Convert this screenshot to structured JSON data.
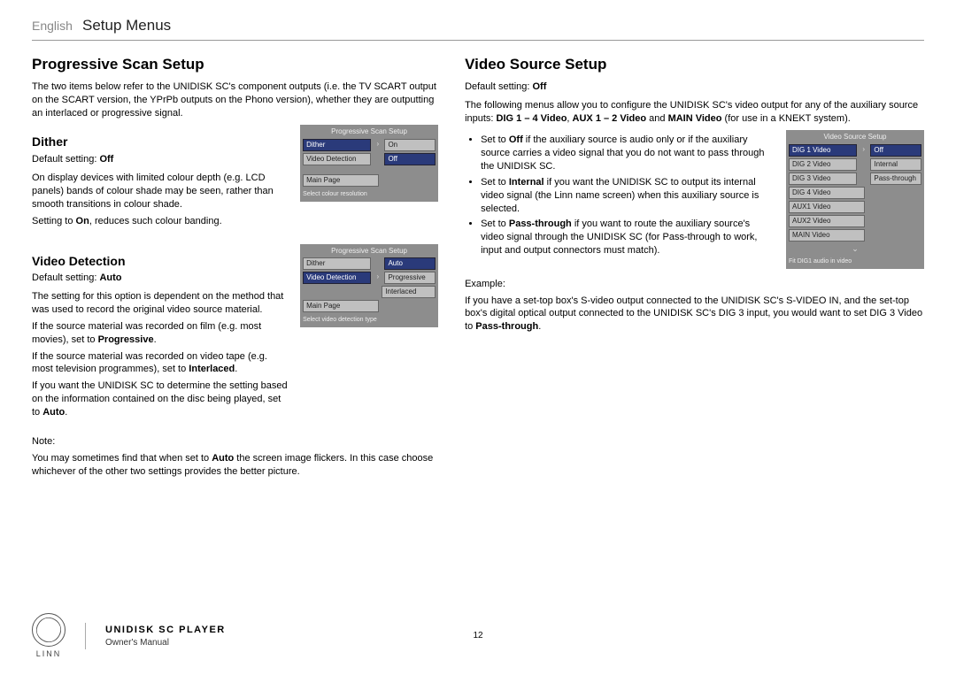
{
  "header": {
    "language": "English",
    "title": "Setup Menus"
  },
  "left": {
    "h2": "Progressive Scan Setup",
    "intro": "The two items below refer to the UNIDISK SC's component outputs (i.e. the TV SCART output on the SCART version, the YPrPb outputs on the Phono version), whether they are outputting an interlaced or progressive signal.",
    "dither": {
      "h3": "Dither",
      "default_label": "Default setting: ",
      "default_value": "Off",
      "p1": "On display devices with limited colour depth (e.g. LCD panels) bands of colour shade may be seen, rather than smooth transitions in colour shade.",
      "p2_a": "Setting to ",
      "p2_b": "On",
      "p2_c": ", reduces such colour banding.",
      "shot": {
        "title": "Progressive Scan Setup",
        "rows": [
          {
            "left": "Dither",
            "sel": true,
            "right": "On",
            "rightSel": false
          },
          {
            "left": "Video Detection",
            "sel": false,
            "right": "Off",
            "rightSel": true
          },
          {
            "left_spacer": true
          },
          {
            "left": "Main Page",
            "sel": false
          }
        ],
        "footer": "Select colour resolution"
      }
    },
    "video_detection": {
      "h3": "Video Detection",
      "default_label": "Default setting: ",
      "default_value": "Auto",
      "p1": "The setting for this option is dependent on the method that was used to record the original video source material.",
      "p2_a": "If the source material was recorded on film (e.g. most movies), set to ",
      "p2_b": "Progressive",
      "p2_c": ".",
      "p3_a": "If the source material was recorded on video tape (e.g. most television programmes), set to ",
      "p3_b": "Interlaced",
      "p3_c": ".",
      "p4_a": "If you want the UNIDISK SC to determine the setting based on the information contained on the disc being played, set to ",
      "p4_b": "Auto",
      "p4_c": ".",
      "shot": {
        "title": "Progressive Scan Setup",
        "rows": [
          {
            "left": "Dither",
            "sel": false,
            "right": "Auto",
            "rightSel": true
          },
          {
            "left": "Video Detection",
            "sel": true,
            "right": "Progressive",
            "rightSel": false
          },
          {
            "left_spacer": true,
            "right": "Interlaced",
            "rightSel": false
          },
          {
            "left": "Main Page",
            "sel": false
          }
        ],
        "footer": "Select video detection type"
      }
    },
    "note_label": "Note:",
    "note_a": "You may sometimes find that when set to ",
    "note_b": "Auto",
    "note_c": " the screen image flickers. In this case choose whichever of the other two settings provides the better picture."
  },
  "right": {
    "h2": "Video Source Setup",
    "default_label": "Default setting: ",
    "default_value": "Off",
    "intro_a": "The following menus allow you to configure the UNIDISK SC's video output for any of the auxiliary source inputs: ",
    "intro_b": "DIG 1 – 4 Video",
    "intro_c": ", ",
    "intro_d": "AUX 1 – 2 Video",
    "intro_e": " and ",
    "intro_f": "MAIN Video",
    "intro_g": " (for use in a KNEKT system).",
    "b1_a": "Set to ",
    "b1_b": "Off",
    "b1_c": " if the auxiliary source is audio only or if the auxiliary source carries a video signal that you do not want to pass through the UNIDISK SC.",
    "b2_a": "Set to ",
    "b2_b": "Internal",
    "b2_c": " if you want the UNIDISK SC to output its internal video signal (the Linn name screen) when this auxiliary source is selected.",
    "b3_a": "Set to ",
    "b3_b": "Pass-through",
    "b3_c": "  if you want to route the auxiliary source's video signal through the UNIDISK SC (for Pass-through to work, input and output connectors must match).",
    "example_label": "Example:",
    "ex_a": "If you have a set-top box's S-video output connected to the UNIDISK SC's S-VIDEO IN, and the set-top box's digital optical output connected to the UNIDISK SC's DIG 3 input, you would want to set DIG 3 Video to ",
    "ex_b": "Pass-through",
    "ex_c": ".",
    "shot": {
      "title": "Video Source Setup",
      "rows": [
        {
          "left": "DIG 1 Video",
          "sel": true,
          "right": "Off",
          "rightSel": true
        },
        {
          "left": "DIG 2 Video",
          "sel": false,
          "right": "Internal",
          "rightSel": false
        },
        {
          "left": "DIG 3 Video",
          "sel": false,
          "right": "Pass-through",
          "rightSel": false
        },
        {
          "left": "DIG 4 Video",
          "sel": false
        },
        {
          "left": "AUX1 Video",
          "sel": false
        },
        {
          "left": "AUX2 Video",
          "sel": false
        },
        {
          "left": "MAIN Video",
          "sel": false
        }
      ],
      "footer": "Fit DIG1 audio in video"
    }
  },
  "footer": {
    "brand": "LINN",
    "product": "UNIDISK SC PLAYER",
    "manual": "Owner's Manual",
    "page": "12"
  }
}
